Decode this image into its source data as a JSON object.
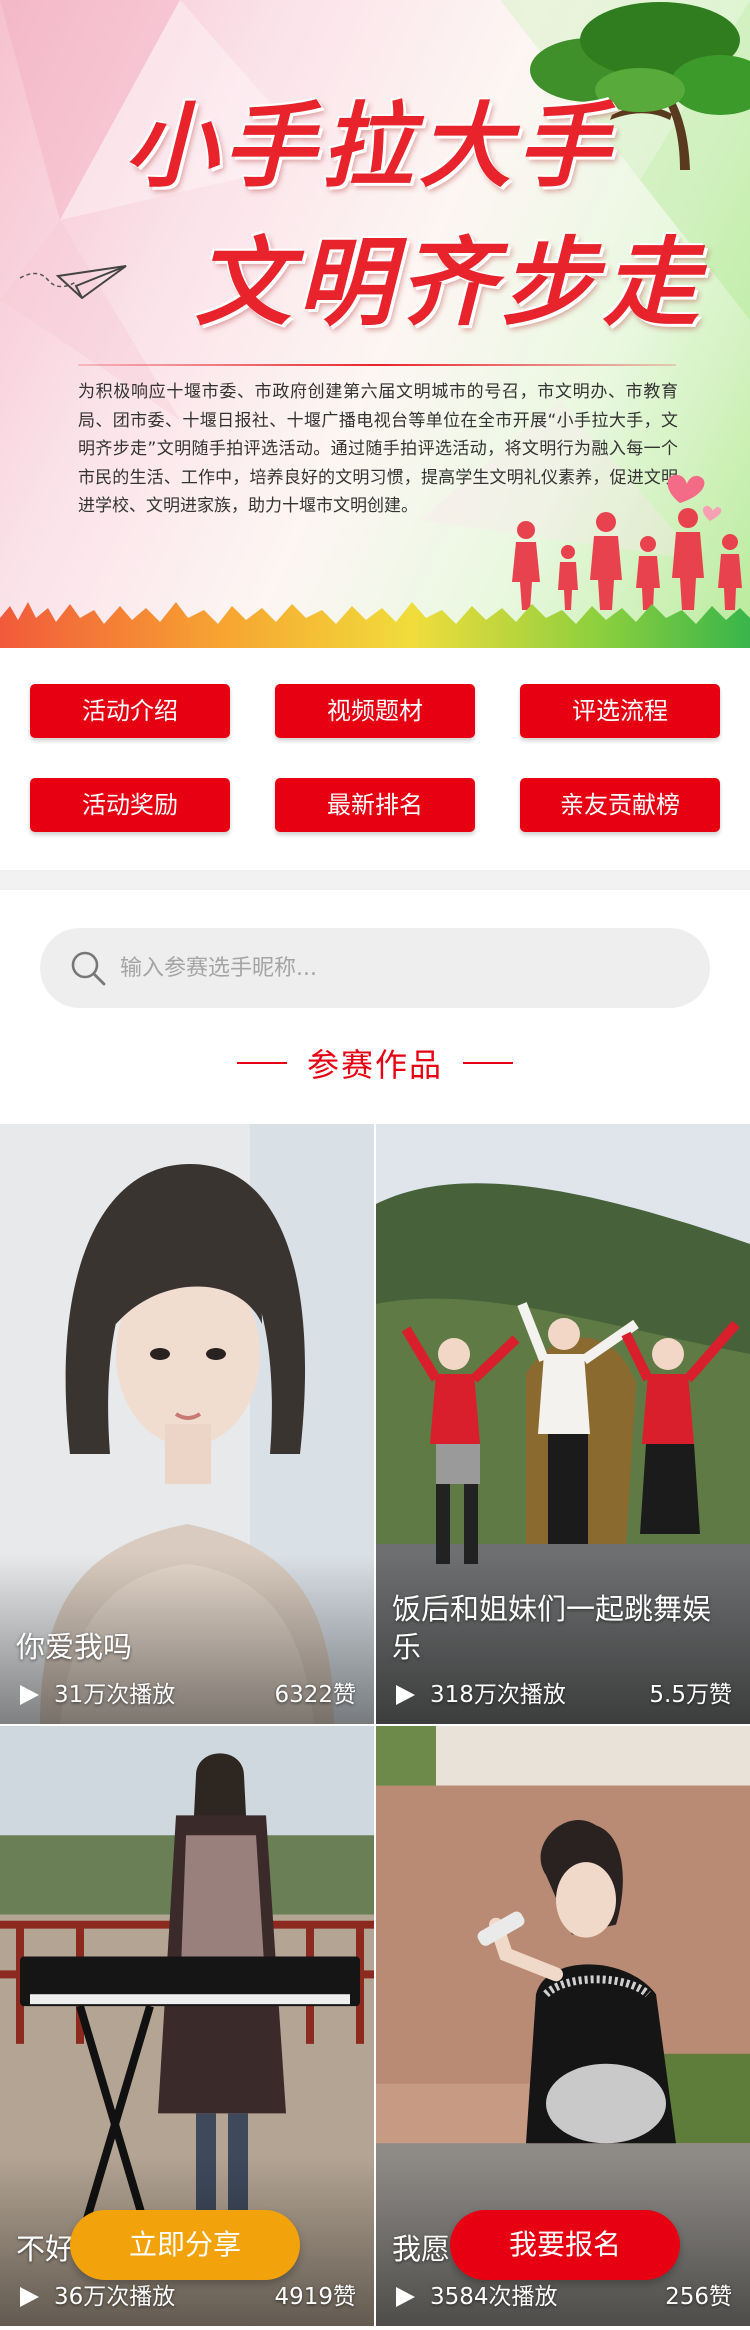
{
  "banner": {
    "title_line1": "小手拉大手",
    "title_line2": "文明齐步走",
    "description": "为积极响应十堰市委、市政府创建第六届文明城市的号召，市文明办、市教育局、团市委、十堰日报社、十堰广播电视台等单位在全市开展“小手拉大手，文明齐步走”文明随手拍评选活动。通过随手拍评选活动，将文明行为融入每一个市民的生活、工作中，培养良好的文明习惯，提高学生文明礼仪素养，促进文明进学校、文明进家族，助力十堰市文明创建。"
  },
  "menu": {
    "items": [
      {
        "label": "活动介绍"
      },
      {
        "label": "视频题材"
      },
      {
        "label": "评选流程"
      },
      {
        "label": "活动奖励"
      },
      {
        "label": "最新排名"
      },
      {
        "label": "亲友贡献榜"
      }
    ]
  },
  "search": {
    "placeholder": "输入参赛选手昵称..."
  },
  "section": {
    "title": "参赛作品"
  },
  "entries": [
    {
      "title": "你爱我吗",
      "plays": "31万次播放",
      "likes": "6322赞"
    },
    {
      "title": "饭后和姐妹们一起跳舞娱乐",
      "plays": "318万次播放",
      "likes": "5.5万赞"
    },
    {
      "title": "不好",
      "plays": "36万次播放",
      "likes": "4919赞"
    },
    {
      "title": "我愿",
      "plays": "3584次播放",
      "likes": "256赞"
    }
  ],
  "actions": {
    "share_label": "立即分享",
    "signup_label": "我要报名"
  },
  "colors": {
    "accent_red": "#e60012",
    "share_orange": "#f2a20a"
  },
  "icons": {
    "search": "search-icon",
    "play": "play-icon",
    "paper_plane": "paper-plane-icon",
    "heart": "heart-icon"
  }
}
